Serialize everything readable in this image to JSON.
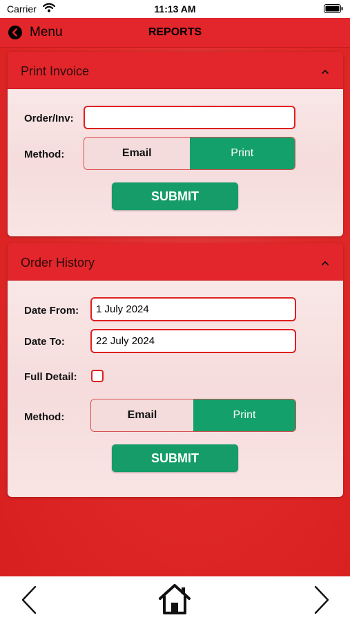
{
  "status_bar": {
    "carrier": "Carrier",
    "time": "11:13 AM",
    "icons": [
      "wifi-icon",
      "battery-icon"
    ]
  },
  "nav": {
    "back_label": "Menu",
    "back_icon": "back-circle-icon",
    "title": "REPORTS"
  },
  "print_invoice": {
    "title": "Print Invoice",
    "order_label": "Order/Inv:",
    "order_value": "",
    "method_label": "Method:",
    "method_options": [
      "Email",
      "Print"
    ],
    "method_selected": "Print",
    "submit_label": "SUBMIT"
  },
  "order_history": {
    "title": "Order History",
    "date_from_label": "Date From:",
    "date_from_value": "1 July 2024",
    "date_to_label": "Date To:",
    "date_to_value": "22 July 2024",
    "full_detail_label": "Full Detail:",
    "full_detail_checked": false,
    "method_label": "Method:",
    "method_options": [
      "Email",
      "Print"
    ],
    "method_selected": "Print",
    "submit_label": "SUBMIT"
  },
  "bottom_nav": {
    "icons": [
      "chevron-left-icon",
      "home-icon",
      "chevron-right-icon"
    ]
  },
  "colors": {
    "header_red": "#e3262b",
    "accent_green": "#159c69",
    "input_border": "#dd2020",
    "panel_body": "#f8e1e1"
  }
}
